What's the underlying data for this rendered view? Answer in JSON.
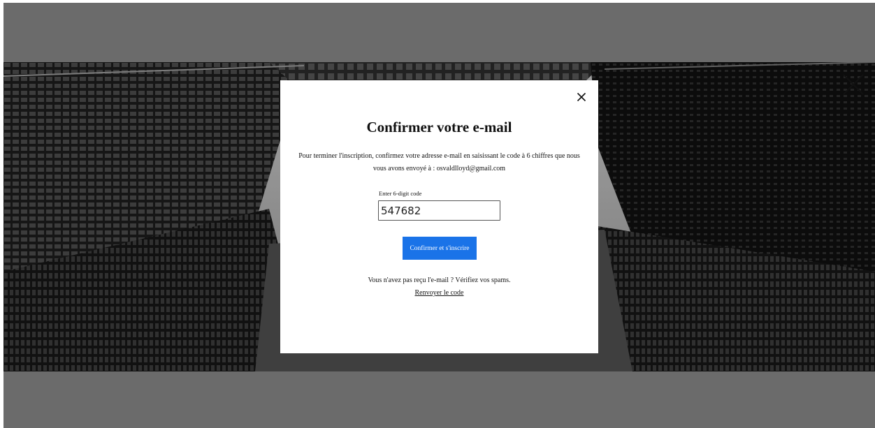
{
  "modal": {
    "title": "Confirmer votre e-mail",
    "description": "Pour terminer l'inscription, confirmez votre adresse e-mail en saisissant le code à 6 chiffres que nous vous avons envoyé à : osvaldlloyd@gmail.com",
    "code_label": "Enter 6-digit code",
    "code_value": "547682",
    "submit_label": "Confirmer et s'inscrire",
    "resend_prompt": "Vous n'avez pas reçu l'e-mail ? Vérifiez vos spams.",
    "resend_link": "Renvoyer le code",
    "close_icon": "close-icon"
  },
  "overlay": {
    "close_icon": "close-icon"
  },
  "colors": {
    "accent": "#1a73e8",
    "backdrop": "#6b6b6b"
  }
}
